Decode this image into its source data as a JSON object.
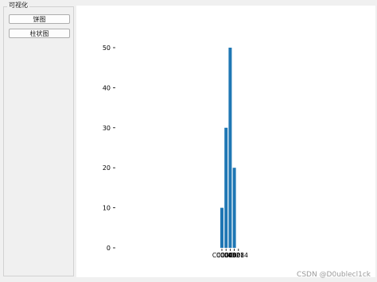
{
  "group": {
    "title": "可视化"
  },
  "buttons": {
    "pie": "饼图",
    "bar": "柱状图"
  },
  "chart_data": {
    "type": "bar",
    "categories": [
      "C0004",
      "C0003",
      "C0002",
      "C0001",
      "C0084"
    ],
    "values": [
      10,
      30,
      50,
      20,
      0
    ],
    "ylim": [
      0,
      55
    ],
    "yticks": [
      0,
      10,
      20,
      30,
      40,
      50
    ],
    "color": "#1f77b4",
    "grid": false
  },
  "watermark": "CSDN @D0ublecl1ck"
}
